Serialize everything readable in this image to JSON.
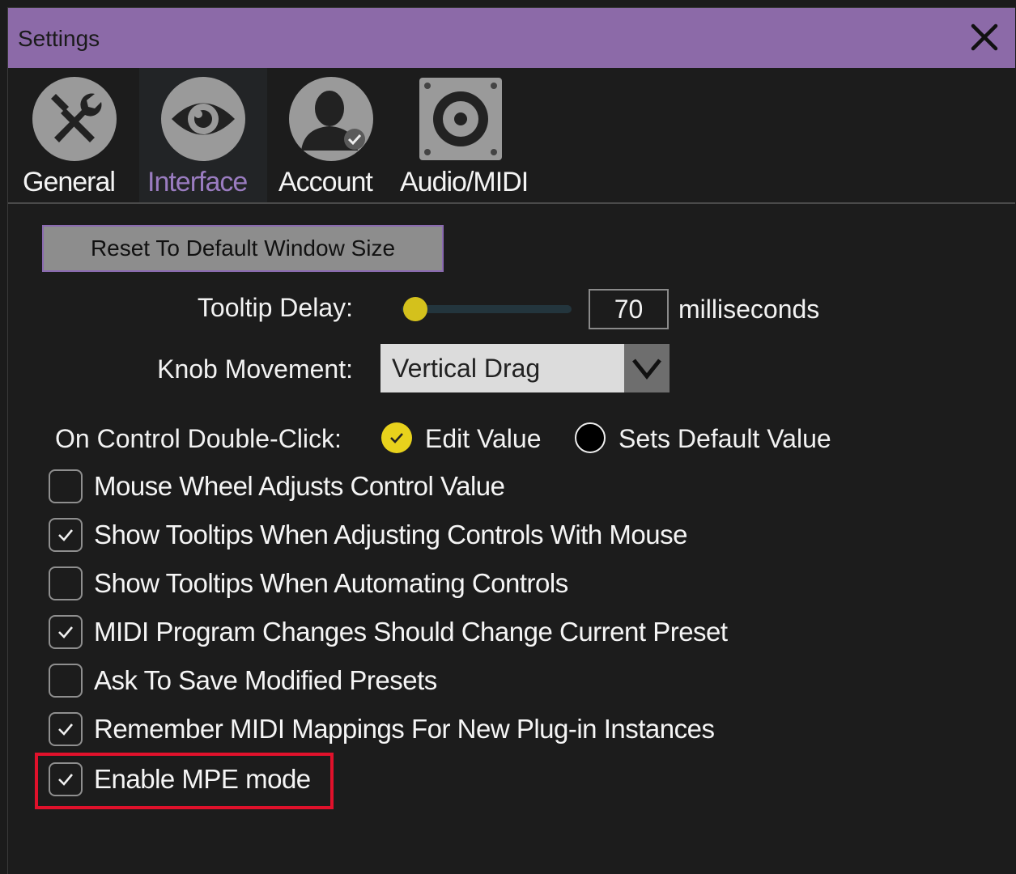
{
  "window": {
    "title": "Settings"
  },
  "tabs": [
    {
      "label": "General",
      "icon": "wrench-screwdriver-icon",
      "active": false
    },
    {
      "label": "Interface",
      "icon": "eye-icon",
      "active": true
    },
    {
      "label": "Account",
      "icon": "user-icon",
      "active": false
    },
    {
      "label": "Audio/MIDI",
      "icon": "speaker-icon",
      "active": false
    }
  ],
  "interface": {
    "reset_button": "Reset To Default Window Size",
    "tooltip_delay": {
      "label": "Tooltip Delay:",
      "value": "70",
      "unit": "milliseconds",
      "slider_fraction": 0.08
    },
    "knob_movement": {
      "label": "Knob Movement:",
      "selected": "Vertical Drag"
    },
    "double_click": {
      "label": "On Control Double-Click:",
      "options": [
        {
          "label": "Edit Value",
          "selected": true
        },
        {
          "label": "Sets Default Value",
          "selected": false
        }
      ]
    },
    "checkboxes": [
      {
        "label": "Mouse Wheel Adjusts Control Value",
        "checked": false
      },
      {
        "label": "Show Tooltips When Adjusting Controls With Mouse",
        "checked": true
      },
      {
        "label": "Show Tooltips When Automating Controls",
        "checked": false
      },
      {
        "label": "MIDI Program Changes Should Change Current Preset",
        "checked": true
      },
      {
        "label": "Ask To Save Modified Presets",
        "checked": false
      },
      {
        "label": "Remember MIDI Mappings For New Plug-in Instances",
        "checked": true
      },
      {
        "label": "Enable MPE mode",
        "checked": true
      }
    ]
  },
  "colors": {
    "titlebar": "#8c6aa8",
    "accent": "#9a7cc0",
    "radio_selected": "#e8d21c",
    "highlight": "#e0112b"
  }
}
